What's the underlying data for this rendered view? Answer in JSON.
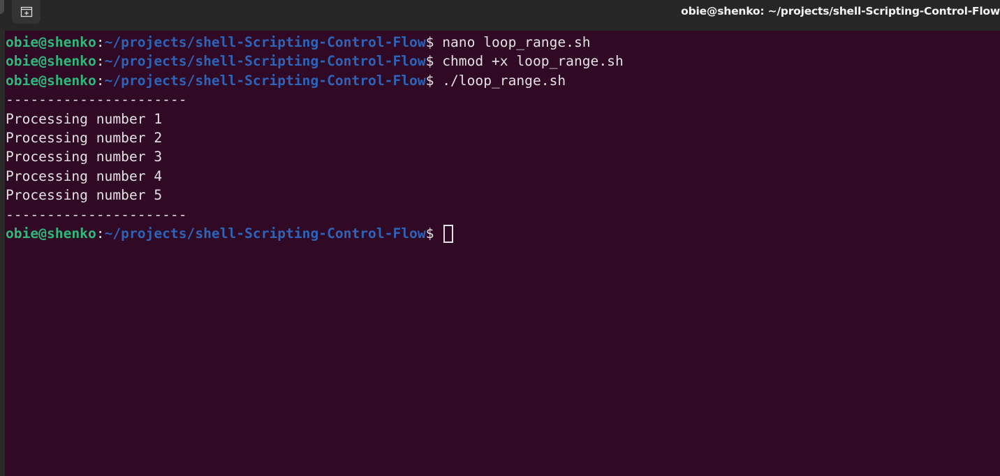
{
  "window": {
    "title": "obie@shenko: ~/projects/shell-Scripting-Control-Flow"
  },
  "titlebar": {
    "new_tab_icon": "new-tab-icon"
  },
  "terminal": {
    "prompt_user": "obie@shenko",
    "prompt_sep": ":",
    "prompt_path": "~/projects/shell-Scripting-Control-Flow",
    "prompt_symbol": "$",
    "commands": [
      " nano loop_range.sh",
      " chmod +x loop_range.sh",
      " ./loop_range.sh"
    ],
    "output": {
      "divider_top": "----------------------",
      "lines": [
        "Processing number 1",
        "Processing number 2",
        "Processing number 3",
        "Processing number 4",
        "Processing number 5"
      ],
      "divider_bottom": "----------------------"
    }
  },
  "colors": {
    "background": "#300a24",
    "user": "#2fb87a",
    "path": "#2d63b8",
    "text": "#e2e2e2",
    "titlebar": "#262626"
  }
}
